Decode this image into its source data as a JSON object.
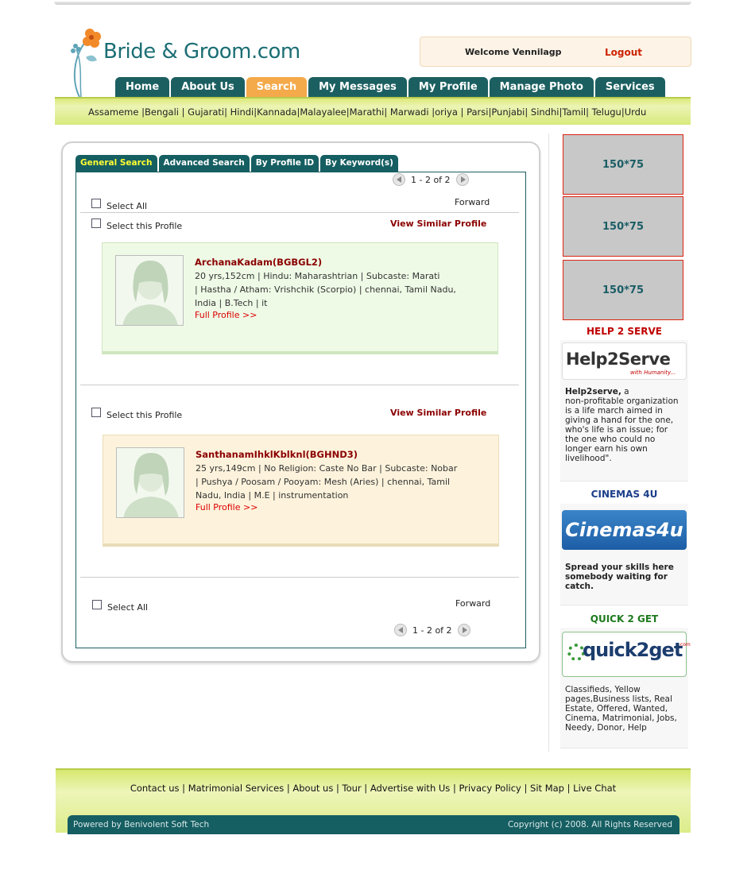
{
  "brand": {
    "name": "Bride & Groom.com",
    "accent": "#1b6e74",
    "logo_flower_color": "#f28a2a"
  },
  "welcome": {
    "text": "Welcome Vennilagp",
    "logout_label": "Logout"
  },
  "nav": {
    "tabs": [
      "Home",
      "About Us",
      "Search",
      "My Messages",
      "My Profile",
      "Manage Photo",
      "Services"
    ],
    "active": "Search"
  },
  "languages": "Assameme |Bengali | Gujarati| Hindi|Kannada|Malayalee|Marathi| Marwadi |oriya | Parsi|Punjabi| Sindhi|Tamil| Telugu|Urdu",
  "search_tabs": [
    "General Search",
    "Advanced Search",
    "By Profile ID",
    "By Keyword(s)"
  ],
  "search_active": "General Search",
  "pager": {
    "text": "1 - 2 of 2"
  },
  "labels": {
    "select_all": "Select All",
    "forward": "Forward",
    "select_profile": "Select this Profile",
    "view_similar": "View Similar Profile",
    "full_profile": "Full Profile >>"
  },
  "profiles": [
    {
      "name": "ArchanaKadam(BGBGL2)",
      "desc_line1": "20 yrs,152cm | Hindu: Maharashtrian | Subcaste: Marati",
      "desc_line2": "| Hastha / Atham: Vrishchik (Scorpio) | chennai, Tamil Nadu,",
      "desc_line3": "India | B.Tech | it"
    },
    {
      "name": "SanthanamIhklKblknl(BGHND3)",
      "desc_line1": "25 yrs,149cm | No Religion: Caste No Bar | Subcaste: Nobar",
      "desc_line2": "| Pushya / Poosam / Pooyam: Mesh (Aries) | chennai, Tamil",
      "desc_line3": "Nadu, India | M.E | instrumentation"
    }
  ],
  "ads": [
    "150*75",
    "150*75",
    "150*75"
  ],
  "sidebar": {
    "help": {
      "heading": "HELP 2 SERVE",
      "logo_main": "Help2Serve",
      "logo_sub": "with Humanity...",
      "bold": "Help2serve,",
      "text_after_bold": " a",
      "text_lines": [
        "non-profitable organization",
        "is a life march aimed in",
        "giving a hand for the one,",
        "who's life is an issue; for",
        "the one who could no",
        "longer earn his own",
        "livelihood\"."
      ]
    },
    "cinemas": {
      "heading": "CINEMAS 4U",
      "logo": "Cinemas4u",
      "text": "Spread your skills here somebody waiting for catch."
    },
    "quick": {
      "heading": "QUICK 2 GET",
      "logo": "quick2get",
      "logo_sub": ".com",
      "text": "Classifieds, Yellow pages,Business lists, Real Estate, Offered, Wanted, Cinema, Matrimonial, Jobs, Needy, Donor, Help"
    }
  },
  "footer": {
    "links": [
      "Contact us",
      "Matrimonial Services",
      "About us",
      "Tour",
      "Advertise with Us",
      "Privacy Policy",
      "Sit Map",
      "Live Chat"
    ],
    "powered": "Powered by Benivolent Soft Tech",
    "copyright": "Copyright (c) 2008. All Rights Reserved"
  },
  "colors": {
    "nav": "#1c5f61",
    "nav_active": "#f4a94a",
    "name_red": "#8b0000",
    "link_red": "#d00",
    "card_green": "#eefae6",
    "card_beige": "#fdf3dc",
    "heading_red": "#c00000",
    "heading_blue": "#1b3e8a",
    "heading_green": "#1e7a1e"
  }
}
